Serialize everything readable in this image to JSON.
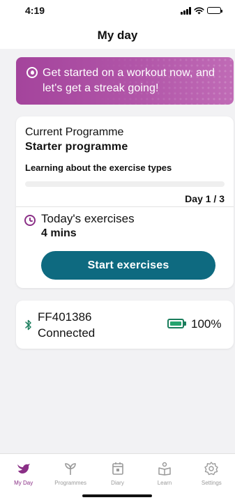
{
  "status_bar": {
    "time": "4:19"
  },
  "header": {
    "title": "My day"
  },
  "banner": {
    "text": "Get started on a workout now, and let's get a streak going!"
  },
  "programme": {
    "label": "Current Programme",
    "name": "Starter programme",
    "description": "Learning about the exercise types",
    "progress": 0,
    "day_counter": "Day 1 / 3"
  },
  "exercises": {
    "label": "Today's exercises",
    "duration": "4 mins",
    "start_label": "Start exercises"
  },
  "device": {
    "id": "FF401386",
    "status": "Connected",
    "battery": "100%"
  },
  "tabs": [
    {
      "label": "My Day",
      "icon": "bird-icon",
      "active": true
    },
    {
      "label": "Programmes",
      "icon": "sprout-icon",
      "active": false
    },
    {
      "label": "Diary",
      "icon": "calendar-icon",
      "active": false
    },
    {
      "label": "Learn",
      "icon": "book-person-icon",
      "active": false
    },
    {
      "label": "Settings",
      "icon": "gear-icon",
      "active": false
    }
  ],
  "colors": {
    "accent": "#8a2f86",
    "primary_button": "#0e6a80",
    "battery_ok": "#24a46e"
  }
}
